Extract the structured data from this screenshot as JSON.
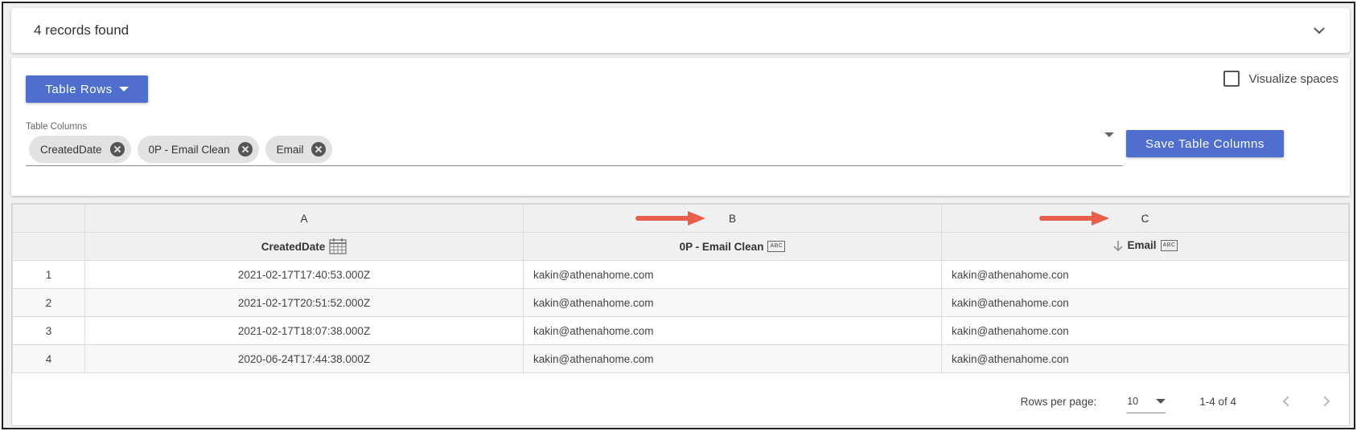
{
  "summary": {
    "title": "4 records found",
    "toggle_icon": "chevron-down-icon"
  },
  "controls": {
    "table_rows_label": "Table Rows",
    "visualize_spaces_label": "Visualize spaces",
    "visualize_spaces_checked": false,
    "table_columns_label": "Table Columns",
    "chips": [
      "CreatedDate",
      "0P - Email Clean",
      "Email"
    ],
    "save_label": "Save Table Columns"
  },
  "table": {
    "letters": [
      "A",
      "B",
      "C"
    ],
    "headers": [
      "CreatedDate",
      "0P - Email Clean",
      "Email"
    ],
    "header_type_abc": "ABC",
    "rows": [
      {
        "index": "1",
        "created": "2021-02-17T17:40:53.000Z",
        "clean": "kakin@athenahome.com",
        "email": "kakin@athenahome.con"
      },
      {
        "index": "2",
        "created": "2021-02-17T20:51:52.000Z",
        "clean": "kakin@athenahome.com",
        "email": "kakin@athenahome.con"
      },
      {
        "index": "3",
        "created": "2021-02-17T18:07:38.000Z",
        "clean": "kakin@athenahome.com",
        "email": "kakin@athenahome.con"
      },
      {
        "index": "4",
        "created": "2020-06-24T17:44:38.000Z",
        "clean": "kakin@athenahome.com",
        "email": "kakin@athenahome.con"
      }
    ]
  },
  "pagination": {
    "rows_per_page_label": "Rows per page:",
    "rows_per_page_value": "10",
    "range": "1-4 of 4"
  },
  "colors": {
    "accent": "#4f6fcf",
    "annotation_arrow": "#e8604c"
  }
}
